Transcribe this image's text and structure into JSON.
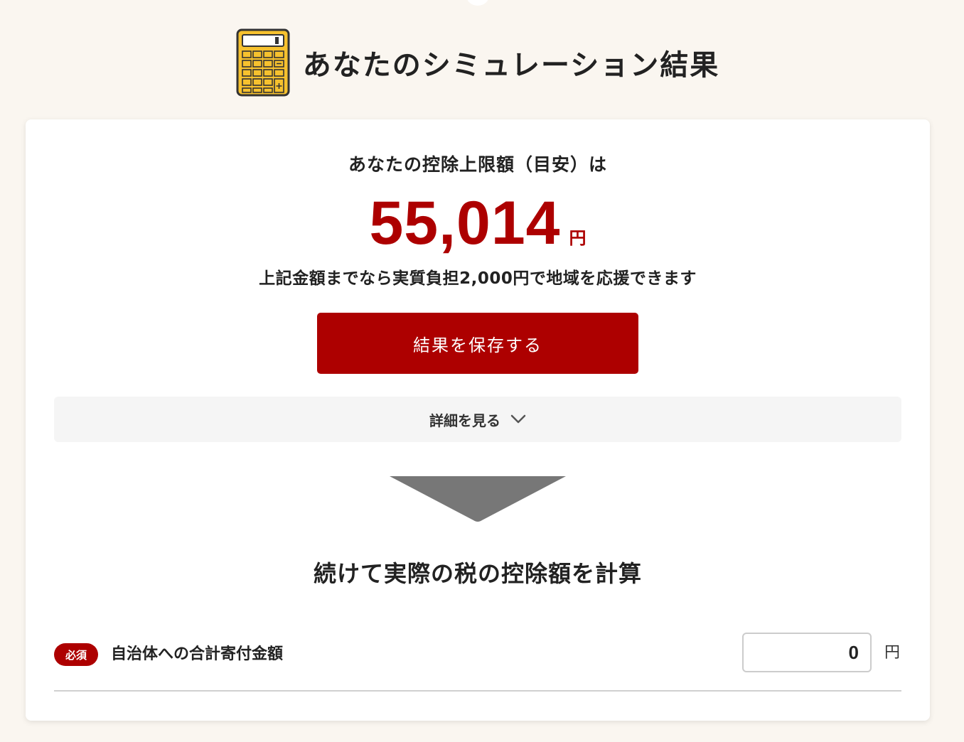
{
  "header": {
    "title": "あなたのシミュレーション結果"
  },
  "result": {
    "limit_label": "あなたの控除上限額（目安）は",
    "amount": "55,014",
    "unit": "円",
    "support_text": "上記金額までなら実質負担2,000円で地域を応援できます",
    "save_button_label": "結果を保存する",
    "details_label": "詳細を見る"
  },
  "calculation": {
    "heading": "続けて実際の税の控除額を計算",
    "required_badge": "必須",
    "donation_label": "自治体への合計寄付金額",
    "donation_value": "0",
    "unit": "円"
  },
  "colors": {
    "accent": "#ad0000",
    "background": "#faf6f0",
    "card": "#ffffff",
    "calculator_body": "#f6c12e"
  },
  "icons": {
    "calculator": "calculator-icon",
    "chevron": "chevron-down-icon",
    "arrow": "arrow-down-icon"
  }
}
